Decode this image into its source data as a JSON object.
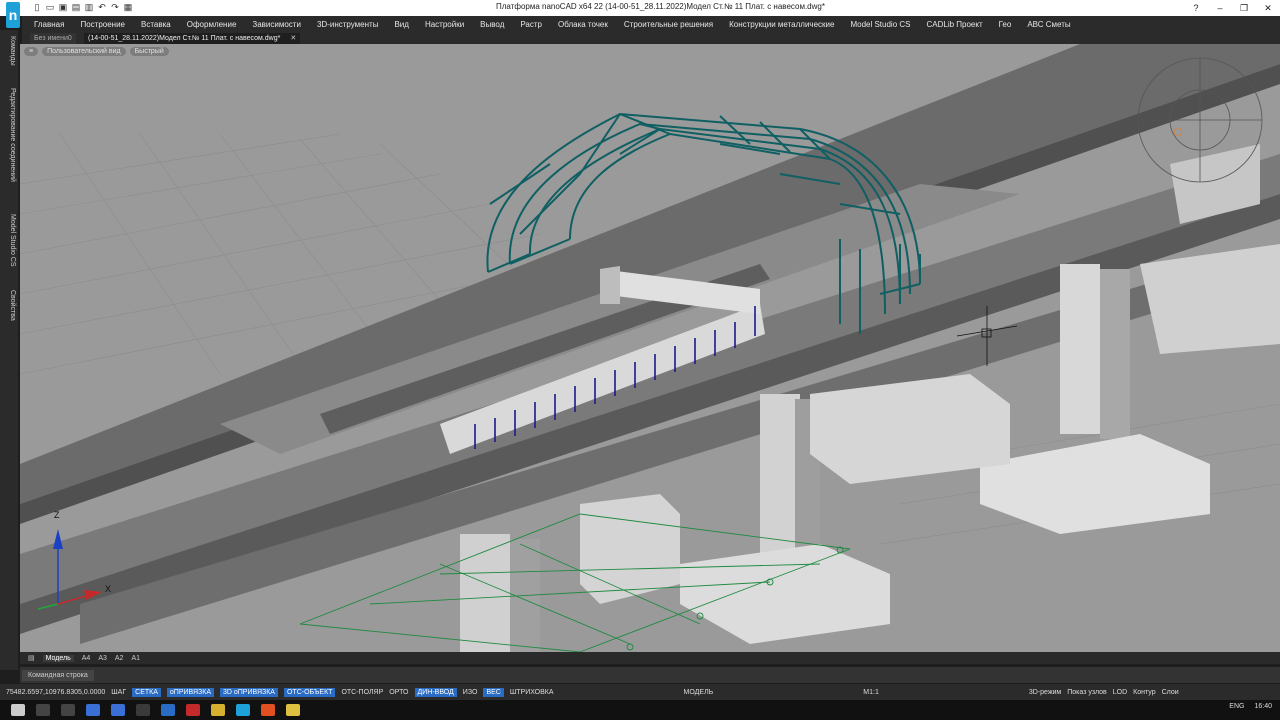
{
  "window": {
    "title": "Платформа nanoCAD x64 22 (14-00-51_28.11.2022)Модел Ст.№ 11 Плат. с навесом.dwg*",
    "minimize": "–",
    "restore": "❐",
    "close": "✕",
    "help": "?"
  },
  "menu": [
    "Главная",
    "Построение",
    "Вставка",
    "Оформление",
    "Зависимости",
    "3D-инструменты",
    "Вид",
    "Настройки",
    "Вывод",
    "Растр",
    "Облака точек",
    "Строительные решения",
    "Конструкции металлические",
    "Model Studio CS",
    "CADLib Проект",
    "Гео",
    "АВС Сметы"
  ],
  "tabs": [
    {
      "label": "Без имени0"
    },
    {
      "label": "(14-00-51_28.11.2022)Модел Ст.№ 11 Плат. с навесом.dwg*"
    }
  ],
  "sidebar": [
    "Команды",
    "Редактирование соединений",
    "Model Studio CS",
    "Свойства"
  ],
  "viewport": {
    "view_name": "Пользовательский вид",
    "visual_style": "Быстрый",
    "menu": "≡",
    "axis_z": "Z",
    "axis_x": "X"
  },
  "layouts": [
    "Модель",
    "A4",
    "A3",
    "A2",
    "A1"
  ],
  "command_line": "Командная строка",
  "status": {
    "coords": "75482.6597,10976.8305,0.0000",
    "toggles": [
      {
        "label": "ШАГ",
        "on": false
      },
      {
        "label": "СЕТКА",
        "on": true
      },
      {
        "label": "оПРИВЯЗКА",
        "on": true
      },
      {
        "label": "3D оПРИВЯЗКА",
        "on": true
      },
      {
        "label": "ОТС-ОБЪЕКТ",
        "on": true
      },
      {
        "label": "ОТС-ПОЛЯР",
        "on": false
      },
      {
        "label": "ОРТО",
        "on": false
      },
      {
        "label": "ДИН-ВВОД",
        "on": true
      },
      {
        "label": "ИЗО",
        "on": false
      },
      {
        "label": "ВЕС",
        "on": true
      },
      {
        "label": "ШТРИХОВКА",
        "on": false
      }
    ],
    "model": "МОДЕЛЬ",
    "scale": "M1:1",
    "right": [
      "3D-режим",
      "Показ узлов",
      "LOD",
      "Контур",
      "Слои"
    ]
  },
  "taskbar": {
    "lang": "ENG",
    "time": "16:40"
  },
  "colors": {
    "truss": "#0f5f63",
    "accent": "#2a6bc4",
    "rebar": "#1a1a8c",
    "grid_green": "#1f8a40"
  }
}
